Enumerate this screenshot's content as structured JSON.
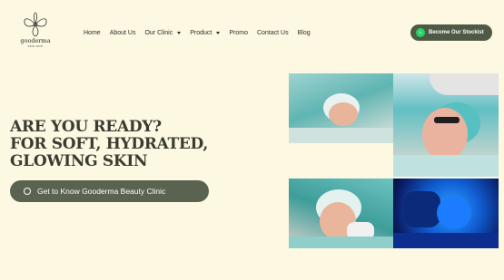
{
  "brand": {
    "name": "gooderma",
    "tagline": "skin care"
  },
  "nav": {
    "items": [
      {
        "label": "Home",
        "dropdown": false
      },
      {
        "label": "About Us",
        "dropdown": false
      },
      {
        "label": "Our Clinic",
        "dropdown": true
      },
      {
        "label": "Product",
        "dropdown": true
      },
      {
        "label": "Promo",
        "dropdown": false
      },
      {
        "label": "Contact Us",
        "dropdown": false
      },
      {
        "label": "Blog",
        "dropdown": false
      }
    ]
  },
  "header": {
    "stockist_label": "Become Our Stockist"
  },
  "hero": {
    "line1": "ARE YOU READY?",
    "line2": "FOR SOFT, HYDRATED,",
    "line3": "GLOWING SKIN",
    "cta_label": "Get to Know Gooderma Beauty Clinic"
  },
  "gallery": {
    "photos": [
      {
        "icon": "facial-treatment-photo"
      },
      {
        "icon": "laser-treatment-photo"
      },
      {
        "icon": "microneedling-photo"
      },
      {
        "icon": "led-mask-photo"
      }
    ]
  },
  "colors": {
    "background": "#fdf8e1",
    "button": "#5a6350",
    "whatsapp": "#25d366",
    "heading": "#3b3b32"
  }
}
